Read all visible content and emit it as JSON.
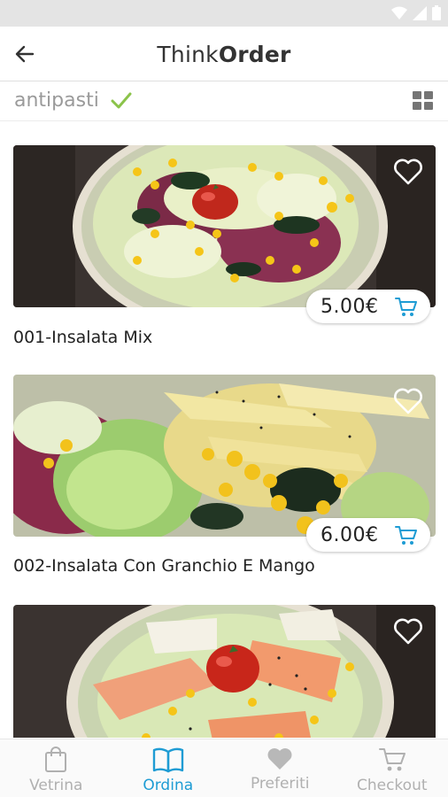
{
  "app": {
    "title_light": "Think",
    "title_bold": "Order"
  },
  "category": {
    "label": "antipasti"
  },
  "products": [
    {
      "name": "001-Insalata Mix",
      "price": "5.00€",
      "favorite": false
    },
    {
      "name": "002-Insalata Con Granchio E Mango",
      "price": "6.00€",
      "favorite": false
    },
    {
      "name": "",
      "price": "",
      "favorite": false
    }
  ],
  "nav": {
    "items": [
      {
        "label": "Vetrina",
        "icon": "shopping-bag-icon",
        "active": false
      },
      {
        "label": "Ordina",
        "icon": "book-icon",
        "active": true
      },
      {
        "label": "Preferiti",
        "icon": "heart-icon",
        "active": false
      },
      {
        "label": "Checkout",
        "icon": "cart-icon",
        "active": false
      }
    ]
  },
  "colors": {
    "accent": "#1e9cd4",
    "check": "#8bc34a",
    "status_bar": "#e4e4e4",
    "inactive": "#b0b0b0"
  }
}
